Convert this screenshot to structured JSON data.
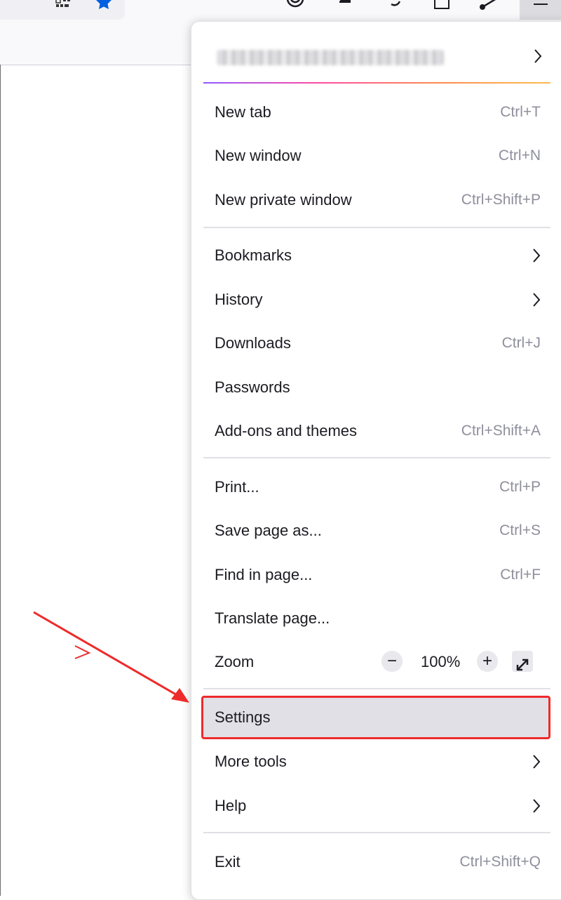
{
  "menu": {
    "account_chevron": "chevron-right-icon",
    "group1": [
      {
        "label": "New tab",
        "accel": "Ctrl+T"
      },
      {
        "label": "New window",
        "accel": "Ctrl+N"
      },
      {
        "label": "New private window",
        "accel": "Ctrl+Shift+P"
      }
    ],
    "group2": [
      {
        "label": "Bookmarks",
        "accel": ""
      },
      {
        "label": "History",
        "accel": ""
      },
      {
        "label": "Downloads",
        "accel": "Ctrl+J"
      },
      {
        "label": "Passwords",
        "accel": ""
      },
      {
        "label": "Add-ons and themes",
        "accel": "Ctrl+Shift+A"
      }
    ],
    "group3": [
      {
        "label": "Print...",
        "accel": "Ctrl+P"
      },
      {
        "label": "Save page as...",
        "accel": "Ctrl+S"
      },
      {
        "label": "Find in page...",
        "accel": "Ctrl+F"
      },
      {
        "label": "Translate page...",
        "accel": ""
      }
    ],
    "zoom": {
      "label": "Zoom",
      "minus": "−",
      "value": "100%",
      "plus": "+"
    },
    "group4": [
      {
        "label": "Settings",
        "accel": ""
      },
      {
        "label": "More tools",
        "accel": ""
      },
      {
        "label": "Help",
        "accel": ""
      }
    ],
    "exit": {
      "label": "Exit",
      "accel": "Ctrl+Shift+Q"
    }
  },
  "colors": {
    "accent_blue": "#0060df",
    "annotation_red": "#ee2b2b",
    "muted_text": "#8f8f9d"
  }
}
